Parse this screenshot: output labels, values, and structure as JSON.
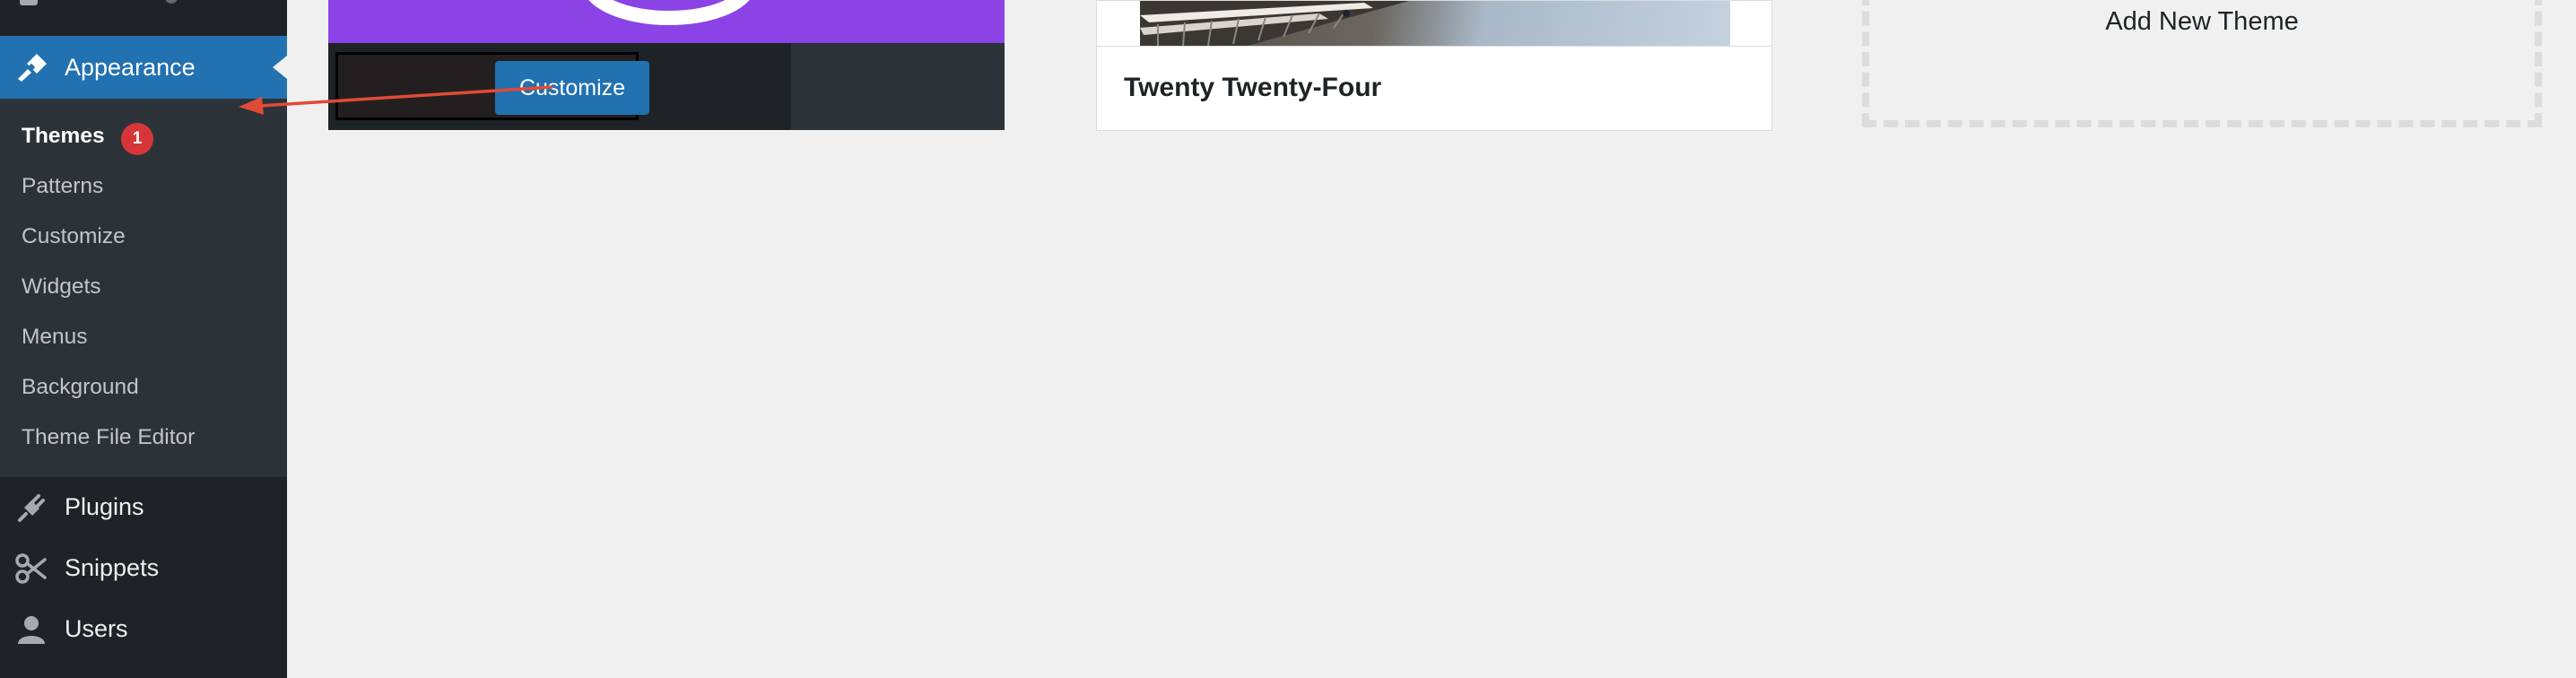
{
  "sidebar": {
    "active_item": {
      "label": "Appearance",
      "icon": "paintbrush-icon"
    },
    "submenu": [
      {
        "label": "Themes",
        "badge": "1",
        "current": true
      },
      {
        "label": "Patterns"
      },
      {
        "label": "Customize"
      },
      {
        "label": "Widgets"
      },
      {
        "label": "Menus"
      },
      {
        "label": "Background"
      },
      {
        "label": "Theme File Editor"
      }
    ],
    "items": [
      {
        "label": "Plugins",
        "icon": "plugins-icon"
      },
      {
        "label": "Snippets",
        "icon": "scissors-icon"
      },
      {
        "label": "Users",
        "icon": "user-icon"
      }
    ]
  },
  "themes": {
    "active": {
      "customize_label": "Customize"
    },
    "cards": [
      {
        "name": "Twenty Twenty-Four"
      }
    ],
    "add_new_label": "Add New Theme"
  },
  "colors": {
    "sidebar_bg": "#1d2327",
    "submenu_bg": "#2c3338",
    "accent": "#2271b1",
    "badge": "#d63638",
    "active_theme_bg": "#8c43e6",
    "annotation_arrow": "#e04b35"
  }
}
